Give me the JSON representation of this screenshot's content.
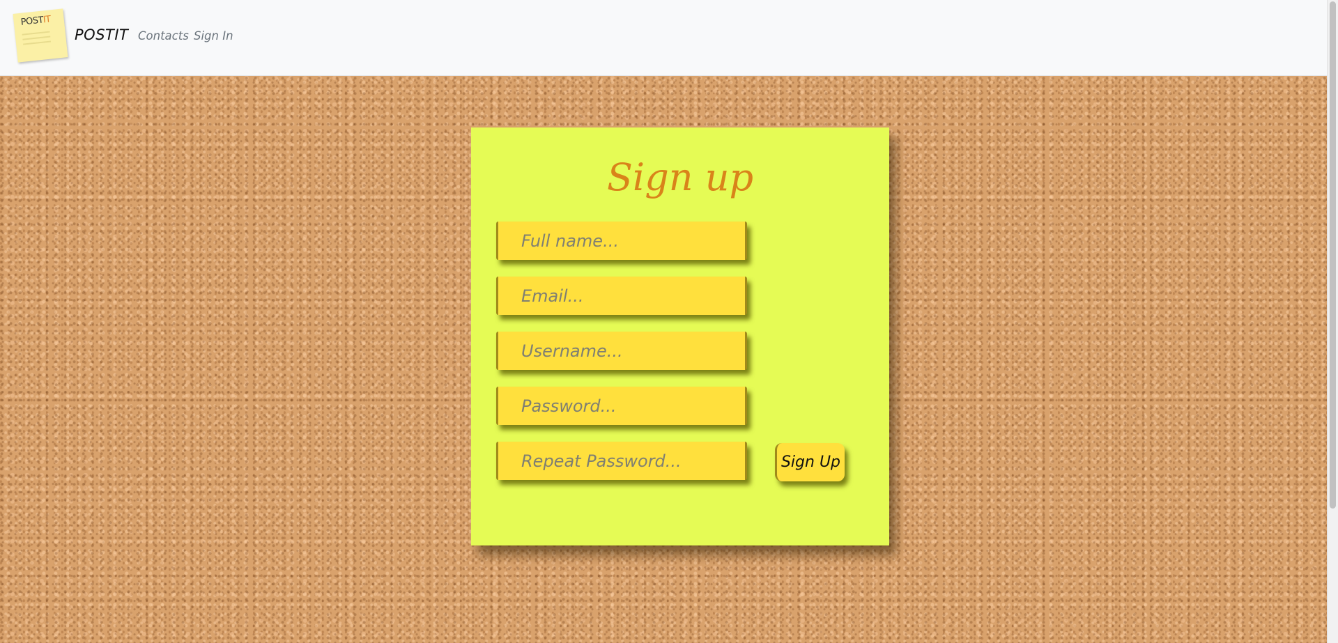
{
  "navbar": {
    "logo": {
      "word_main": "POST",
      "word_accent": "IT",
      "accent_color": "#e07f2a"
    },
    "brand": "POSTIT",
    "links": [
      {
        "label": "Contacts"
      },
      {
        "label": "Sign In"
      }
    ]
  },
  "signup": {
    "title": "Sign up",
    "fields": [
      {
        "placeholder": "Full name...",
        "value": ""
      },
      {
        "placeholder": "Email...",
        "value": ""
      },
      {
        "placeholder": "Username...",
        "value": ""
      },
      {
        "placeholder": "Password...",
        "value": ""
      },
      {
        "placeholder": "Repeat Password...",
        "value": ""
      }
    ],
    "submit_label": "Sign Up"
  },
  "colors": {
    "card": "#e5fb55",
    "field": "#ffe03d",
    "title": "#d9831a",
    "cork": "#d9a26c"
  }
}
